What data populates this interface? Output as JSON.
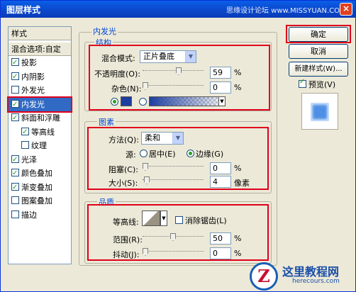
{
  "window": {
    "title": "图层样式",
    "watermark": "思缘设计论坛 www.MISSYUAN.COM",
    "close_glyph": "×"
  },
  "styles_panel": {
    "header": "样式",
    "blend_options": "混合选项:自定",
    "items": [
      {
        "label": "投影",
        "checked": true
      },
      {
        "label": "内阴影",
        "checked": true
      },
      {
        "label": "外发光",
        "checked": false
      },
      {
        "label": "内发光",
        "checked": true,
        "selected": true
      },
      {
        "label": "斜面和浮雕",
        "checked": true
      },
      {
        "label": "等高线",
        "checked": true
      },
      {
        "label": "纹理",
        "checked": false
      },
      {
        "label": "光泽",
        "checked": true
      },
      {
        "label": "颜色叠加",
        "checked": true
      },
      {
        "label": "渐变叠加",
        "checked": true
      },
      {
        "label": "图案叠加",
        "checked": false
      },
      {
        "label": "描边",
        "checked": false
      }
    ]
  },
  "inner_glow": {
    "title": "内发光",
    "structure": {
      "title": "结构",
      "blend_mode_label": "混合模式:",
      "blend_mode_value": "正片叠底",
      "opacity_label": "不透明度(O):",
      "opacity_value": "59",
      "opacity_unit": "%",
      "noise_label": "杂色(N):",
      "noise_value": "0",
      "noise_unit": "%",
      "color": "#1e3fa0"
    },
    "elements": {
      "title": "图素",
      "method_label": "方法(Q):",
      "method_value": "柔和",
      "source_label": "源:",
      "source_center": "居中(E)",
      "source_edge": "边缘(G)",
      "choke_label": "阻塞(C):",
      "choke_value": "0",
      "choke_unit": "%",
      "size_label": "大小(S):",
      "size_value": "4",
      "size_unit": "像素"
    },
    "quality": {
      "title": "品质",
      "contour_label": "等高线:",
      "anti_alias_label": "消除锯齿(L)",
      "range_label": "范围(R):",
      "range_value": "50",
      "range_unit": "%",
      "jitter_label": "抖动(J):",
      "jitter_value": "0",
      "jitter_unit": "%"
    }
  },
  "buttons": {
    "ok": "确定",
    "cancel": "取消",
    "new_style": "新建样式(W)...",
    "preview_label": "预览(V)"
  },
  "site_logo": {
    "mark": "Z",
    "name": "这里教程网",
    "url": "herecours.com"
  }
}
